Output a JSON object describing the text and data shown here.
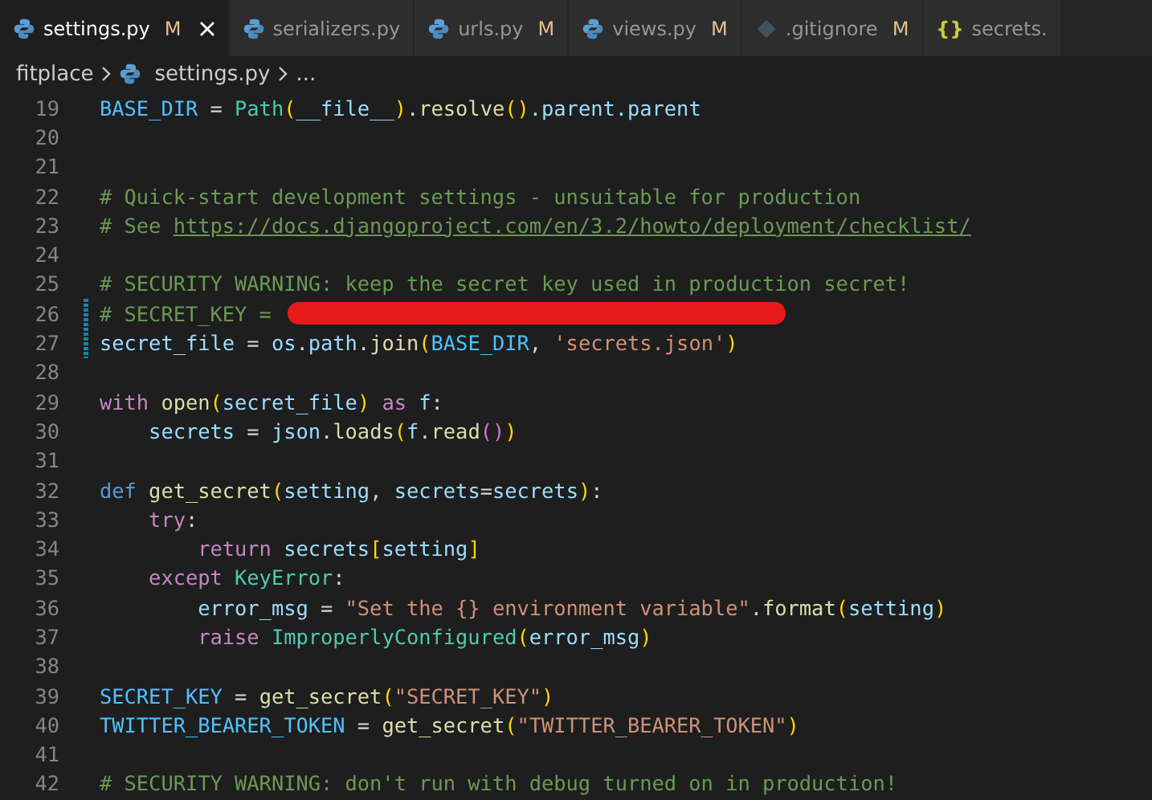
{
  "tabs": [
    {
      "label": "settings.py",
      "kind": "python",
      "modified": "M",
      "selected": true,
      "closable": true
    },
    {
      "label": "serializers.py",
      "kind": "python",
      "selected": false,
      "closable": false
    },
    {
      "label": "urls.py",
      "kind": "python",
      "modified": "M",
      "selected": false,
      "closable": false
    },
    {
      "label": "views.py",
      "kind": "python",
      "modified": "M",
      "selected": false,
      "closable": false
    },
    {
      "label": ".gitignore",
      "kind": "git",
      "modified": "M",
      "selected": false,
      "closable": false
    },
    {
      "label": "secrets.",
      "kind": "glyph",
      "glyph": "{}",
      "selected": false,
      "closable": false
    }
  ],
  "breadcrumb": {
    "folder": "fitplace",
    "file": "settings.py",
    "more": "..."
  },
  "lines": [
    {
      "number": "19",
      "changed": false,
      "tokens": [
        {
          "text": "BASE_DIR",
          "kind": "const"
        },
        {
          "text": " = ",
          "kind": "plain"
        },
        {
          "text": "Path",
          "kind": "type"
        },
        {
          "text": "(",
          "kind": "br1"
        },
        {
          "text": "__file__",
          "kind": "var"
        },
        {
          "text": ")",
          "kind": "br1"
        },
        {
          "text": ".",
          "kind": "plain"
        },
        {
          "text": "resolve",
          "kind": "fn"
        },
        {
          "text": "()",
          "kind": "br1"
        },
        {
          "text": ".parent.parent",
          "kind": "var"
        }
      ]
    },
    {
      "number": "20",
      "changed": false
    },
    {
      "number": "21",
      "changed": false
    },
    {
      "number": "22",
      "changed": false,
      "tokens": [
        {
          "text": "# Quick-start development settings - unsuitable for production",
          "kind": "comment"
        }
      ]
    },
    {
      "number": "23",
      "changed": false,
      "tokens": [
        {
          "text": "# See ",
          "kind": "comment"
        },
        {
          "text": "https://docs.djangoproject.com/en/3.2/howto/deployment/checklist/",
          "kind": "link"
        }
      ]
    },
    {
      "number": "24",
      "changed": false
    },
    {
      "number": "25",
      "changed": false,
      "tokens": [
        {
          "text": "# SECURITY WARNING: keep the secret key used in production secret!",
          "kind": "comment"
        }
      ]
    },
    {
      "number": "26",
      "changed": true,
      "redacted": true,
      "tokens": [
        {
          "text": "# SECRET_KEY = ",
          "kind": "comment"
        }
      ]
    },
    {
      "number": "27",
      "changed": true,
      "tokens": [
        {
          "text": "secret_file",
          "kind": "var"
        },
        {
          "text": " = ",
          "kind": "plain"
        },
        {
          "text": "os",
          "kind": "var"
        },
        {
          "text": ".",
          "kind": "plain"
        },
        {
          "text": "path",
          "kind": "var"
        },
        {
          "text": ".",
          "kind": "plain"
        },
        {
          "text": "join",
          "kind": "fn"
        },
        {
          "text": "(",
          "kind": "br1"
        },
        {
          "text": "BASE_DIR",
          "kind": "const"
        },
        {
          "text": ", ",
          "kind": "plain"
        },
        {
          "text": "'secrets.json'",
          "kind": "str"
        },
        {
          "text": ")",
          "kind": "br1"
        }
      ]
    },
    {
      "number": "28",
      "changed": false
    },
    {
      "number": "29",
      "changed": false,
      "tokens": [
        {
          "text": "with",
          "kind": "ctl"
        },
        {
          "text": " open",
          "kind": "fn"
        },
        {
          "text": "(",
          "kind": "br1"
        },
        {
          "text": "secret_file",
          "kind": "var"
        },
        {
          "text": ")",
          "kind": "br1"
        },
        {
          "text": " as",
          "kind": "ctl"
        },
        {
          "text": " f",
          "kind": "var"
        },
        {
          "text": ":",
          "kind": "plain"
        }
      ]
    },
    {
      "number": "30",
      "changed": false,
      "tokens": [
        {
          "text": "    secrets",
          "kind": "var"
        },
        {
          "text": " = ",
          "kind": "plain"
        },
        {
          "text": "json",
          "kind": "var"
        },
        {
          "text": ".",
          "kind": "plain"
        },
        {
          "text": "loads",
          "kind": "fn"
        },
        {
          "text": "(",
          "kind": "br1"
        },
        {
          "text": "f",
          "kind": "var"
        },
        {
          "text": ".",
          "kind": "plain"
        },
        {
          "text": "read",
          "kind": "fn"
        },
        {
          "text": "()",
          "kind": "br2"
        },
        {
          "text": ")",
          "kind": "br1"
        }
      ]
    },
    {
      "number": "31",
      "changed": false
    },
    {
      "number": "32",
      "changed": false,
      "tokens": [
        {
          "text": "def",
          "kind": "kw"
        },
        {
          "text": " get_secret",
          "kind": "fn"
        },
        {
          "text": "(",
          "kind": "br1"
        },
        {
          "text": "setting",
          "kind": "var"
        },
        {
          "text": ", ",
          "kind": "plain"
        },
        {
          "text": "secrets",
          "kind": "var"
        },
        {
          "text": "=",
          "kind": "plain"
        },
        {
          "text": "secrets",
          "kind": "var"
        },
        {
          "text": ")",
          "kind": "br1"
        },
        {
          "text": ":",
          "kind": "plain"
        }
      ]
    },
    {
      "number": "33",
      "changed": false,
      "tokens": [
        {
          "text": "    try",
          "kind": "ctl"
        },
        {
          "text": ":",
          "kind": "plain"
        }
      ]
    },
    {
      "number": "34",
      "changed": false,
      "tokens": [
        {
          "text": "        return",
          "kind": "ctl"
        },
        {
          "text": " secrets",
          "kind": "var"
        },
        {
          "text": "[",
          "kind": "br1"
        },
        {
          "text": "setting",
          "kind": "var"
        },
        {
          "text": "]",
          "kind": "br1"
        }
      ]
    },
    {
      "number": "35",
      "changed": false,
      "tokens": [
        {
          "text": "    except",
          "kind": "ctl"
        },
        {
          "text": " KeyError",
          "kind": "type"
        },
        {
          "text": ":",
          "kind": "plain"
        }
      ]
    },
    {
      "number": "36",
      "changed": false,
      "tokens": [
        {
          "text": "        error_msg",
          "kind": "var"
        },
        {
          "text": " = ",
          "kind": "plain"
        },
        {
          "text": "\"Set the {} environment variable\"",
          "kind": "str"
        },
        {
          "text": ".",
          "kind": "plain"
        },
        {
          "text": "format",
          "kind": "fn"
        },
        {
          "text": "(",
          "kind": "br1"
        },
        {
          "text": "setting",
          "kind": "var"
        },
        {
          "text": ")",
          "kind": "br1"
        }
      ]
    },
    {
      "number": "37",
      "changed": false,
      "tokens": [
        {
          "text": "        raise",
          "kind": "ctl"
        },
        {
          "text": " ImproperlyConfigured",
          "kind": "type"
        },
        {
          "text": "(",
          "kind": "br1"
        },
        {
          "text": "error_msg",
          "kind": "var"
        },
        {
          "text": ")",
          "kind": "br1"
        }
      ]
    },
    {
      "number": "38",
      "changed": false
    },
    {
      "number": "39",
      "changed": false,
      "tokens": [
        {
          "text": "SECRET_KEY",
          "kind": "const"
        },
        {
          "text": " = ",
          "kind": "plain"
        },
        {
          "text": "get_secret",
          "kind": "fn"
        },
        {
          "text": "(",
          "kind": "br1"
        },
        {
          "text": "\"SECRET_KEY\"",
          "kind": "str"
        },
        {
          "text": ")",
          "kind": "br1"
        }
      ]
    },
    {
      "number": "40",
      "changed": false,
      "tokens": [
        {
          "text": "TWITTER_BEARER_TOKEN",
          "kind": "const"
        },
        {
          "text": " = ",
          "kind": "plain"
        },
        {
          "text": "get_secret",
          "kind": "fn"
        },
        {
          "text": "(",
          "kind": "br1"
        },
        {
          "text": "\"TWITTER_BEARER_TOKEN\"",
          "kind": "str"
        },
        {
          "text": ")",
          "kind": "br1"
        }
      ]
    },
    {
      "number": "41",
      "changed": false
    },
    {
      "number": "42",
      "changed": false,
      "tokens": [
        {
          "text": "# SECURITY WARNING: don't run with debug turned on in production!",
          "kind": "comment"
        }
      ]
    }
  ]
}
